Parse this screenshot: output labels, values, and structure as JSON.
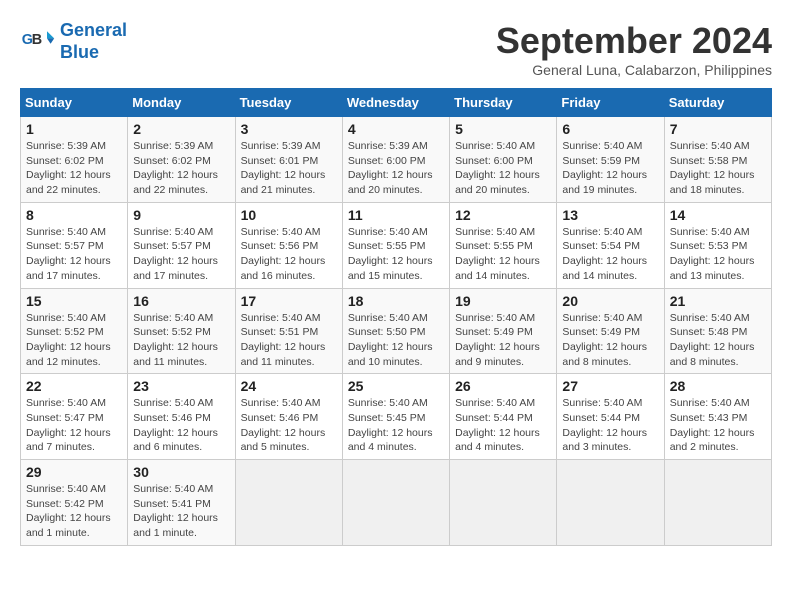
{
  "header": {
    "logo_line1": "General",
    "logo_line2": "Blue",
    "month": "September 2024",
    "location": "General Luna, Calabarzon, Philippines"
  },
  "calendar": {
    "days_of_week": [
      "Sunday",
      "Monday",
      "Tuesday",
      "Wednesday",
      "Thursday",
      "Friday",
      "Saturday"
    ],
    "weeks": [
      [
        {
          "day": "",
          "empty": true
        },
        {
          "day": "",
          "empty": true
        },
        {
          "day": "",
          "empty": true
        },
        {
          "day": "",
          "empty": true
        },
        {
          "day": "",
          "empty": true
        },
        {
          "day": "",
          "empty": true
        },
        {
          "day": "",
          "empty": true
        }
      ],
      [
        {
          "day": "1",
          "sunrise": "5:39 AM",
          "sunset": "6:02 PM",
          "daylight": "12 hours and 22 minutes."
        },
        {
          "day": "2",
          "sunrise": "5:39 AM",
          "sunset": "6:02 PM",
          "daylight": "12 hours and 22 minutes."
        },
        {
          "day": "3",
          "sunrise": "5:39 AM",
          "sunset": "6:01 PM",
          "daylight": "12 hours and 21 minutes."
        },
        {
          "day": "4",
          "sunrise": "5:39 AM",
          "sunset": "6:00 PM",
          "daylight": "12 hours and 20 minutes."
        },
        {
          "day": "5",
          "sunrise": "5:40 AM",
          "sunset": "6:00 PM",
          "daylight": "12 hours and 20 minutes."
        },
        {
          "day": "6",
          "sunrise": "5:40 AM",
          "sunset": "5:59 PM",
          "daylight": "12 hours and 19 minutes."
        },
        {
          "day": "7",
          "sunrise": "5:40 AM",
          "sunset": "5:58 PM",
          "daylight": "12 hours and 18 minutes."
        }
      ],
      [
        {
          "day": "8",
          "sunrise": "5:40 AM",
          "sunset": "5:57 PM",
          "daylight": "12 hours and 17 minutes."
        },
        {
          "day": "9",
          "sunrise": "5:40 AM",
          "sunset": "5:57 PM",
          "daylight": "12 hours and 17 minutes."
        },
        {
          "day": "10",
          "sunrise": "5:40 AM",
          "sunset": "5:56 PM",
          "daylight": "12 hours and 16 minutes."
        },
        {
          "day": "11",
          "sunrise": "5:40 AM",
          "sunset": "5:55 PM",
          "daylight": "12 hours and 15 minutes."
        },
        {
          "day": "12",
          "sunrise": "5:40 AM",
          "sunset": "5:55 PM",
          "daylight": "12 hours and 14 minutes."
        },
        {
          "day": "13",
          "sunrise": "5:40 AM",
          "sunset": "5:54 PM",
          "daylight": "12 hours and 14 minutes."
        },
        {
          "day": "14",
          "sunrise": "5:40 AM",
          "sunset": "5:53 PM",
          "daylight": "12 hours and 13 minutes."
        }
      ],
      [
        {
          "day": "15",
          "sunrise": "5:40 AM",
          "sunset": "5:52 PM",
          "daylight": "12 hours and 12 minutes."
        },
        {
          "day": "16",
          "sunrise": "5:40 AM",
          "sunset": "5:52 PM",
          "daylight": "12 hours and 11 minutes."
        },
        {
          "day": "17",
          "sunrise": "5:40 AM",
          "sunset": "5:51 PM",
          "daylight": "12 hours and 11 minutes."
        },
        {
          "day": "18",
          "sunrise": "5:40 AM",
          "sunset": "5:50 PM",
          "daylight": "12 hours and 10 minutes."
        },
        {
          "day": "19",
          "sunrise": "5:40 AM",
          "sunset": "5:49 PM",
          "daylight": "12 hours and 9 minutes."
        },
        {
          "day": "20",
          "sunrise": "5:40 AM",
          "sunset": "5:49 PM",
          "daylight": "12 hours and 8 minutes."
        },
        {
          "day": "21",
          "sunrise": "5:40 AM",
          "sunset": "5:48 PM",
          "daylight": "12 hours and 8 minutes."
        }
      ],
      [
        {
          "day": "22",
          "sunrise": "5:40 AM",
          "sunset": "5:47 PM",
          "daylight": "12 hours and 7 minutes."
        },
        {
          "day": "23",
          "sunrise": "5:40 AM",
          "sunset": "5:46 PM",
          "daylight": "12 hours and 6 minutes."
        },
        {
          "day": "24",
          "sunrise": "5:40 AM",
          "sunset": "5:46 PM",
          "daylight": "12 hours and 5 minutes."
        },
        {
          "day": "25",
          "sunrise": "5:40 AM",
          "sunset": "5:45 PM",
          "daylight": "12 hours and 4 minutes."
        },
        {
          "day": "26",
          "sunrise": "5:40 AM",
          "sunset": "5:44 PM",
          "daylight": "12 hours and 4 minutes."
        },
        {
          "day": "27",
          "sunrise": "5:40 AM",
          "sunset": "5:44 PM",
          "daylight": "12 hours and 3 minutes."
        },
        {
          "day": "28",
          "sunrise": "5:40 AM",
          "sunset": "5:43 PM",
          "daylight": "12 hours and 2 minutes."
        }
      ],
      [
        {
          "day": "29",
          "sunrise": "5:40 AM",
          "sunset": "5:42 PM",
          "daylight": "12 hours and 1 minute."
        },
        {
          "day": "30",
          "sunrise": "5:40 AM",
          "sunset": "5:41 PM",
          "daylight": "12 hours and 1 minute."
        },
        {
          "day": "",
          "empty": true
        },
        {
          "day": "",
          "empty": true
        },
        {
          "day": "",
          "empty": true
        },
        {
          "day": "",
          "empty": true
        },
        {
          "day": "",
          "empty": true
        }
      ]
    ]
  }
}
